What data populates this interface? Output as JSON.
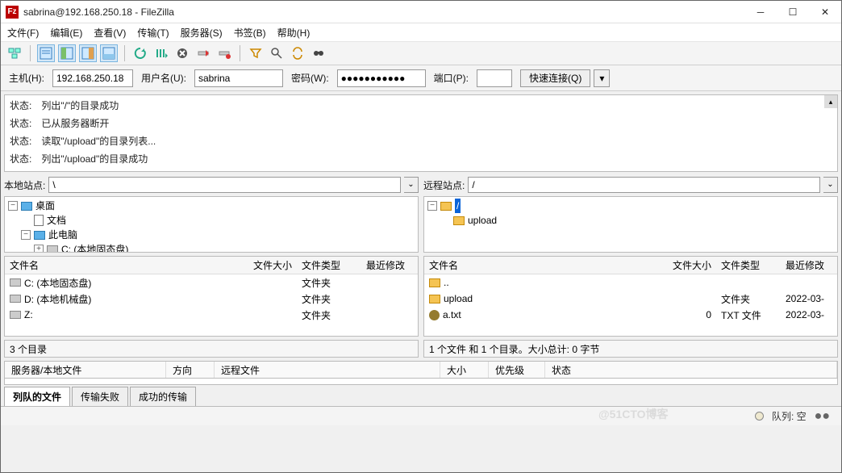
{
  "window": {
    "title": "sabrina@192.168.250.18 - FileZilla"
  },
  "menu": {
    "file": "文件(F)",
    "edit": "编辑(E)",
    "view": "查看(V)",
    "transfer": "传输(T)",
    "server": "服务器(S)",
    "bookmark": "书签(B)",
    "help": "帮助(H)"
  },
  "quick": {
    "host_label": "主机(H):",
    "host": "192.168.250.18",
    "user_label": "用户名(U):",
    "user": "sabrina",
    "pass_label": "密码(W):",
    "pass": "●●●●●●●●●●●",
    "port_label": "端口(P):",
    "port": "",
    "connect": "快速连接(Q)"
  },
  "log": {
    "k": "状态:",
    "l1": "列出\"/\"的目录成功",
    "l2": "已从服务器断开",
    "l3": "读取\"/upload\"的目录列表...",
    "l4": "列出\"/upload\"的目录成功"
  },
  "local": {
    "site_label": "本地站点:",
    "path": "\\",
    "tree": {
      "desktop": "桌面",
      "docs": "文档",
      "thispc": "此电脑",
      "cdrive": "C: (本地固态盘)"
    },
    "cols": {
      "name": "文件名",
      "size": "文件大小",
      "type": "文件类型",
      "mod": "最近修改"
    },
    "rows": [
      {
        "name": "C: (本地固态盘)",
        "type": "文件夹"
      },
      {
        "name": "D: (本地机械盘)",
        "type": "文件夹"
      },
      {
        "name": "Z:",
        "type": "文件夹"
      }
    ],
    "status": "3 个目录"
  },
  "remote": {
    "site_label": "远程站点:",
    "path": "/",
    "tree": {
      "root": "/",
      "upload": "upload"
    },
    "cols": {
      "name": "文件名",
      "size": "文件大小",
      "type": "文件类型",
      "mod": "最近修改"
    },
    "rows": [
      {
        "name": "..",
        "size": "",
        "type": "",
        "mod": ""
      },
      {
        "name": "upload",
        "size": "",
        "type": "文件夹",
        "mod": "2022-03-"
      },
      {
        "name": "a.txt",
        "size": "0",
        "type": "TXT 文件",
        "mod": "2022-03-"
      }
    ],
    "status": "1 个文件 和 1 个目录。大小总计: 0 字节"
  },
  "queue": {
    "cols": {
      "server": "服务器/本地文件",
      "dir": "方向",
      "remote": "远程文件",
      "size": "大小",
      "prio": "优先级",
      "stat": "状态"
    },
    "tabs": {
      "queued": "列队的文件",
      "failed": "传输失败",
      "ok": "成功的传输"
    },
    "footer": "队列: 空"
  },
  "watermark": "@51CTO博客"
}
